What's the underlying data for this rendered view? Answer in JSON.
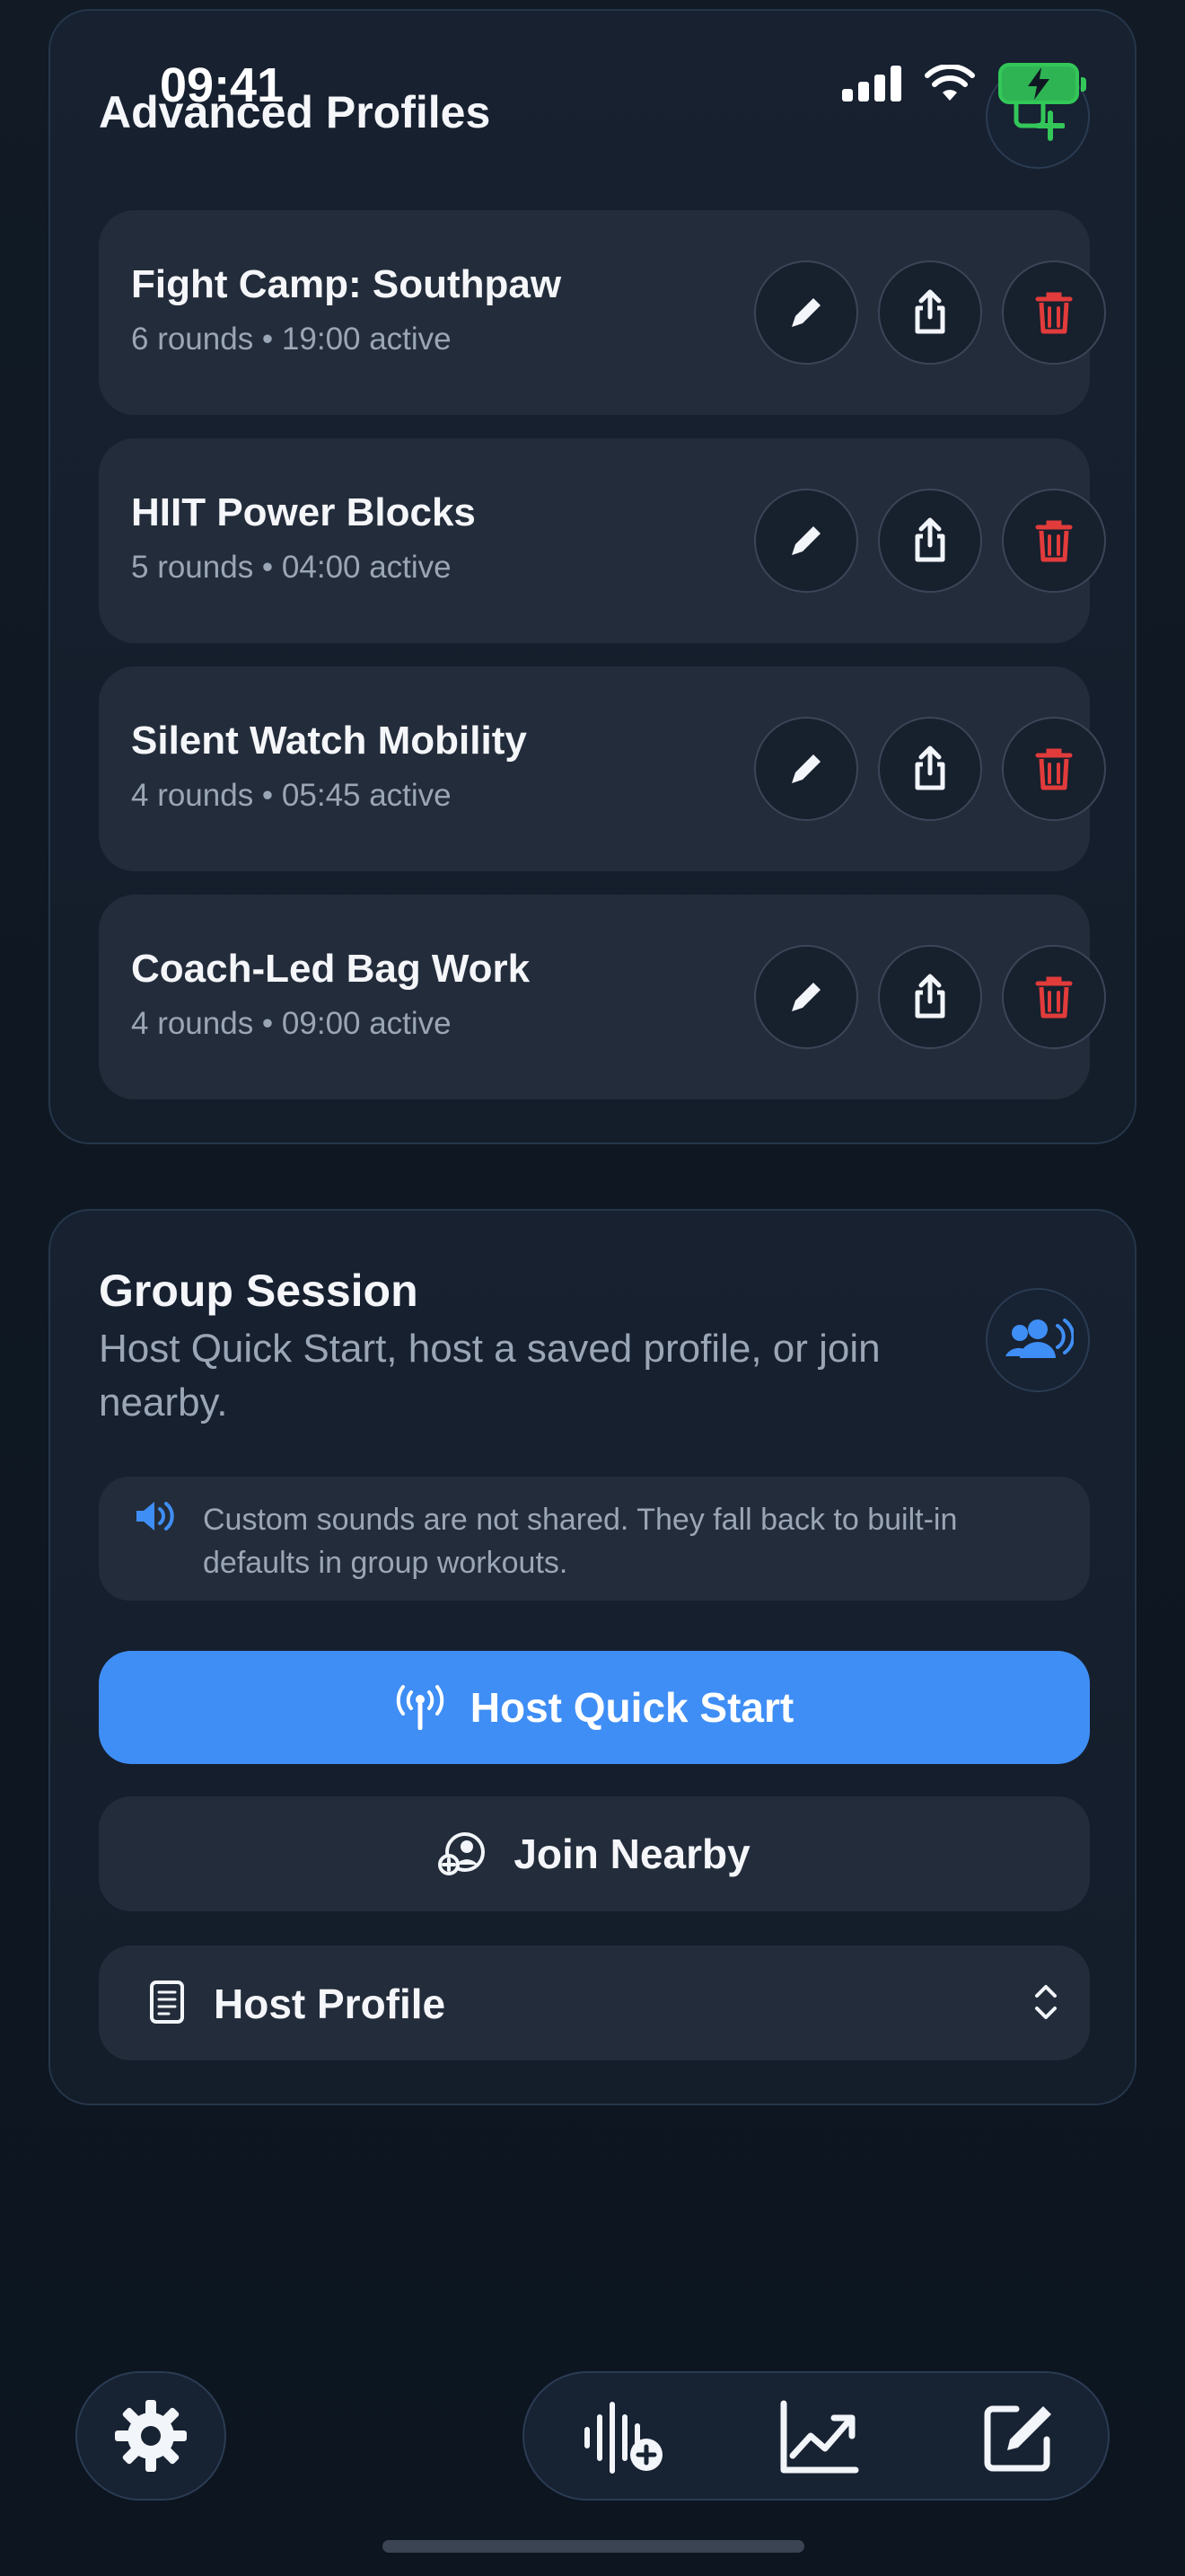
{
  "status_bar": {
    "time": "09:41"
  },
  "profiles_card": {
    "title": "Advanced Profiles",
    "profiles": [
      {
        "name": "Fight Camp: Southpaw",
        "meta": "6 rounds • 19:00 active"
      },
      {
        "name": "HIIT Power Blocks",
        "meta": "5 rounds • 04:00 active"
      },
      {
        "name": "Silent Watch Mobility",
        "meta": "4 rounds • 05:45 active"
      },
      {
        "name": "Coach-Led Bag Work",
        "meta": "4 rounds • 09:00 active"
      }
    ]
  },
  "group_card": {
    "title": "Group Session",
    "subtitle": "Host Quick Start, host a saved profile, or join nearby.",
    "notice": "Custom sounds are not shared. They fall back to built-in defaults in group workouts.",
    "host_quick_start_label": "Host Quick Start",
    "join_nearby_label": "Join Nearby",
    "host_profile_label": "Host Profile"
  },
  "colors": {
    "accent": "#3f8ef5",
    "delete": "#e23b3b",
    "add_badge": "#33c759"
  },
  "icons": {
    "header_profiles": "add-profile-icon",
    "edit": "pencil-icon",
    "share": "share-icon",
    "delete": "trash-icon",
    "group": "group-broadcast-icon",
    "notice": "speaker-icon",
    "host": "antenna-icon",
    "join": "join-person-icon",
    "host_profile": "document-icon",
    "select": "chevron-up-down-icon",
    "settings": "gear-icon",
    "sounds": "waveform-add-icon",
    "stats": "chart-trend-icon",
    "compose": "compose-icon"
  }
}
